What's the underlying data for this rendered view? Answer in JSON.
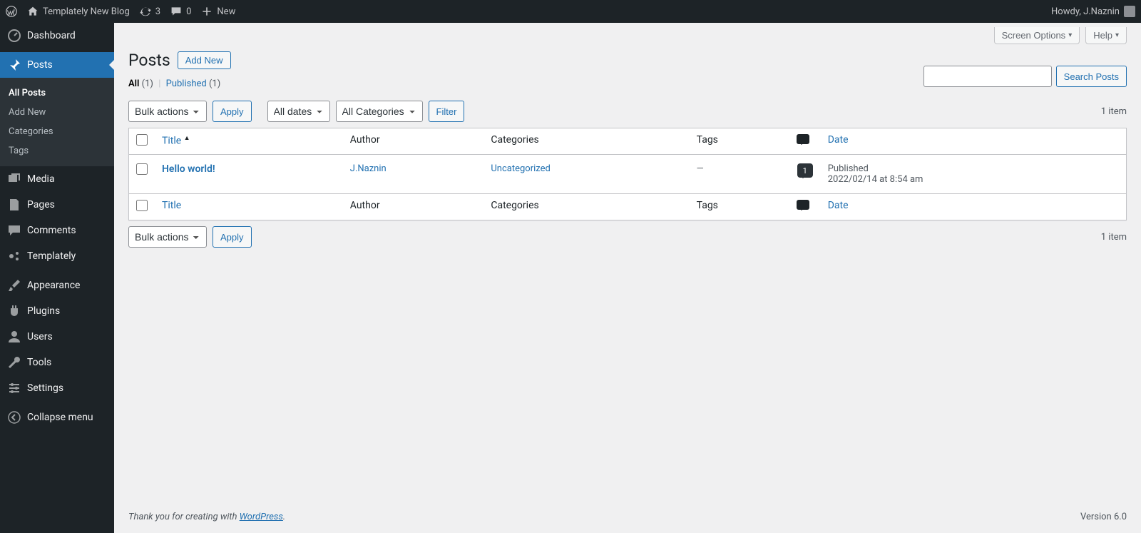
{
  "adminbar": {
    "site_name": "Templately New Blog",
    "updates": "3",
    "comments": "0",
    "new_label": "New",
    "howdy": "Howdy, J.Naznin"
  },
  "sidebar": {
    "dashboard": "Dashboard",
    "posts": "Posts",
    "sub_all": "All Posts",
    "sub_add": "Add New",
    "sub_cat": "Categories",
    "sub_tags": "Tags",
    "media": "Media",
    "pages": "Pages",
    "comments": "Comments",
    "templately": "Templately",
    "appearance": "Appearance",
    "plugins": "Plugins",
    "users": "Users",
    "tools": "Tools",
    "settings": "Settings",
    "collapse": "Collapse menu"
  },
  "screen": {
    "options": "Screen Options",
    "help": "Help"
  },
  "page": {
    "heading": "Posts",
    "add_new": "Add New",
    "views": {
      "all_label": "All",
      "all_count": "(1)",
      "pub_label": "Published",
      "pub_count": "(1)"
    },
    "bulk": "Bulk actions",
    "apply": "Apply",
    "all_dates": "All dates",
    "all_cats": "All Categories",
    "filter": "Filter",
    "item_count": "1 item",
    "search_btn": "Search Posts",
    "cols": {
      "title": "Title",
      "author": "Author",
      "categories": "Categories",
      "tags": "Tags",
      "date": "Date"
    }
  },
  "rows": [
    {
      "title": "Hello world!",
      "author": "J.Naznin",
      "category": "Uncategorized",
      "tags": "—",
      "comments": "1",
      "date_status": "Published",
      "date_value": "2022/02/14 at 8:54 am"
    }
  ],
  "footer": {
    "thanks_pre": "Thank you for creating with ",
    "wp": "WordPress",
    "dot": ".",
    "version": "Version 6.0"
  }
}
